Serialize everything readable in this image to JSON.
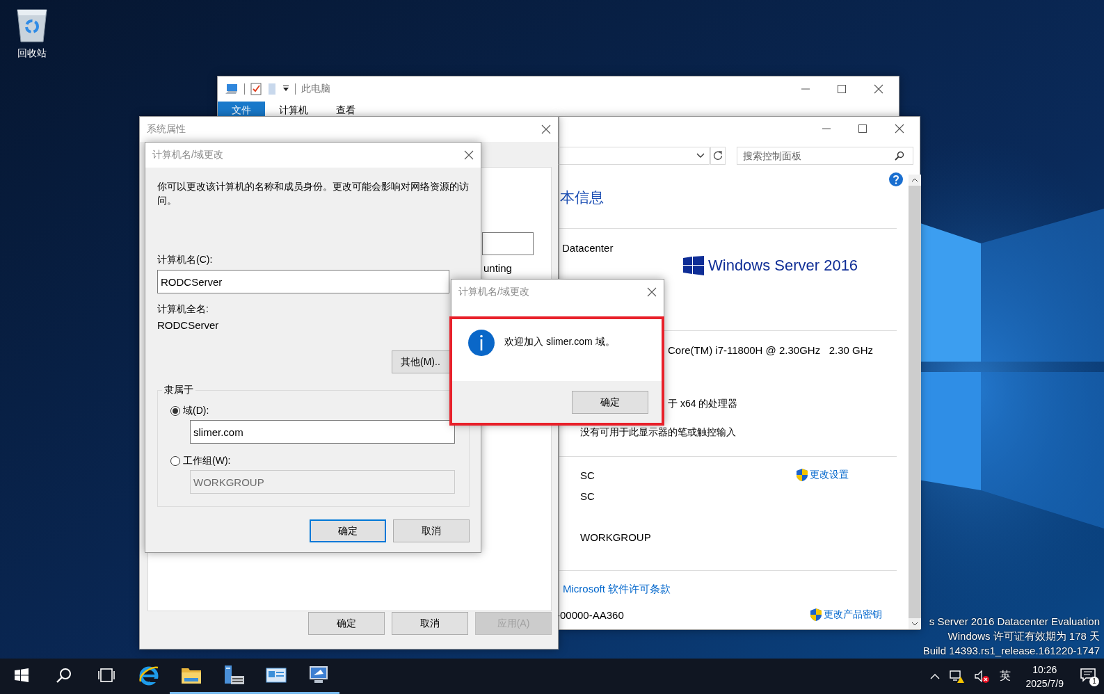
{
  "desktop": {
    "icons": [
      {
        "label": "回收站"
      }
    ],
    "watermark": [
      "s Server 2016 Datacenter Evaluation",
      "Windows 许可证有效期为 178 天",
      "Build 14393.rs1_release.161220-1747"
    ]
  },
  "explorer": {
    "title": "此电脑",
    "ribbon_tabs": [
      {
        "label": "文件",
        "selected": true
      },
      {
        "label": "计算机",
        "selected": false
      },
      {
        "label": "查看",
        "selected": false
      }
    ]
  },
  "control_panel": {
    "search": {
      "placeholder": "搜索控制面板"
    },
    "heading": "本信息",
    "edition": "Datacenter",
    "logo_text": "Windows Server",
    "logo_year": "2016",
    "processor": "Core(TM) i7-11800H @ 2.30GHz   2.30 GHz",
    "system_type": "于 x64 的处理器",
    "pen": "没有可用于此显示器的笔或触控输入",
    "computer_name": "SC",
    "full_name": "SC",
    "workgroup": "WORKGROUP",
    "change_settings": "更改设置",
    "license_link": "Microsoft 软件许可条款",
    "product_id": "-00000-AA360",
    "change_key": "更改产品密钥"
  },
  "system_properties": {
    "title": "系统属性",
    "behind_text": "unting",
    "buttons": [
      {
        "label": "确定",
        "disabled": false
      },
      {
        "label": "取消",
        "disabled": false
      },
      {
        "label": "应用(A)",
        "disabled": true
      }
    ]
  },
  "name_dialog": {
    "title": "计算机名/域更改",
    "description": "你可以更改该计算机的名称和成员身份。更改可能会影响对网络资源的访问。",
    "name_label": "计算机名(C):",
    "name_value": "RODCServer",
    "full_name_label": "计算机全名:",
    "full_name": "RODCServer",
    "more_button": "其他(M)..",
    "group_label": "隶属于",
    "membership": [
      {
        "label": "域(D):",
        "selected": true,
        "value": "slimer.com",
        "disabled": false
      },
      {
        "label": "工作组(W):",
        "selected": false,
        "value": "WORKGROUP",
        "disabled": true
      }
    ],
    "buttons": [
      {
        "label": "确定",
        "default": true
      },
      {
        "label": "取消",
        "default": false
      }
    ]
  },
  "message_box": {
    "title": "计算机名/域更改",
    "message": "欢迎加入 slimer.com 域。",
    "button": "确定",
    "highlighted": true
  },
  "taskbar": {
    "apps": [
      {
        "kind": "start",
        "running": false
      },
      {
        "kind": "search",
        "running": false
      },
      {
        "kind": "taskview",
        "running": false
      },
      {
        "kind": "ie",
        "running": false
      },
      {
        "kind": "folder",
        "running": true
      },
      {
        "kind": "server",
        "running": true
      },
      {
        "kind": "panel",
        "running": true
      },
      {
        "kind": "monitor",
        "running": true
      }
    ],
    "ime": "英",
    "time": "10:26",
    "date": "2025/7/9",
    "notifications": "1"
  }
}
